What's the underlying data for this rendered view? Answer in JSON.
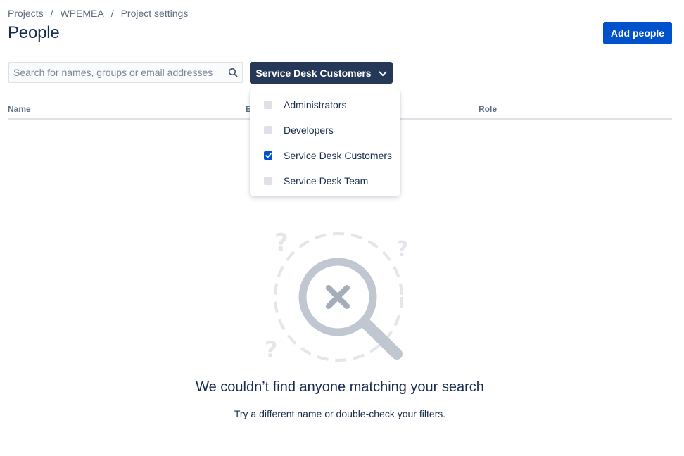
{
  "breadcrumb": {
    "items": [
      "Projects",
      "WPEMEA",
      "Project settings"
    ],
    "separator": "/"
  },
  "page": {
    "title": "People",
    "add_button_label": "Add people"
  },
  "search": {
    "placeholder": "Search for names, groups or email addresses",
    "value": ""
  },
  "role_filter": {
    "label": "Service Desk Customers",
    "options": [
      {
        "label": "Administrators",
        "checked": false
      },
      {
        "label": "Developers",
        "checked": false
      },
      {
        "label": "Service Desk Customers",
        "checked": true
      },
      {
        "label": "Service Desk Team",
        "checked": false
      }
    ]
  },
  "table": {
    "columns": [
      "Name",
      "E",
      "Role"
    ]
  },
  "empty_state": {
    "title": "We couldn’t find anyone matching your search",
    "subtitle": "Try a different name or double-check your filters."
  },
  "colors": {
    "primary": "#0052cc",
    "dark_button": "#253858",
    "text": "#172b4d",
    "subtle_text": "#5e6c84",
    "border": "#dfe1e6"
  }
}
